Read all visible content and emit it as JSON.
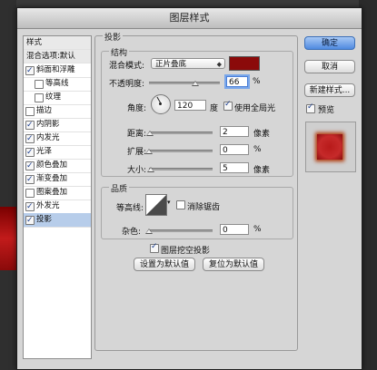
{
  "window": {
    "title": "图层样式"
  },
  "sidebar": {
    "items": [
      {
        "label": "样式",
        "checkbox": false,
        "checked": false,
        "head": true,
        "indent": 0
      },
      {
        "label": "混合选项:默认",
        "checkbox": false,
        "checked": false,
        "head": true,
        "indent": 0
      },
      {
        "label": "斜面和浮雕",
        "checkbox": true,
        "checked": true,
        "indent": 0
      },
      {
        "label": "等高线",
        "checkbox": true,
        "checked": false,
        "indent": 1
      },
      {
        "label": "纹理",
        "checkbox": true,
        "checked": false,
        "indent": 1
      },
      {
        "label": "描边",
        "checkbox": true,
        "checked": false,
        "indent": 0
      },
      {
        "label": "内阴影",
        "checkbox": true,
        "checked": true,
        "indent": 0
      },
      {
        "label": "内发光",
        "checkbox": true,
        "checked": true,
        "indent": 0
      },
      {
        "label": "光泽",
        "checkbox": true,
        "checked": true,
        "indent": 0
      },
      {
        "label": "颜色叠加",
        "checkbox": true,
        "checked": true,
        "indent": 0
      },
      {
        "label": "渐变叠加",
        "checkbox": true,
        "checked": true,
        "indent": 0
      },
      {
        "label": "图案叠加",
        "checkbox": true,
        "checked": false,
        "indent": 0
      },
      {
        "label": "外发光",
        "checkbox": true,
        "checked": true,
        "indent": 0
      },
      {
        "label": "投影",
        "checkbox": true,
        "checked": true,
        "indent": 0,
        "selected": true
      }
    ]
  },
  "drop_shadow": {
    "title": "投影",
    "structure": {
      "title": "结构",
      "blend_mode_label": "混合模式:",
      "blend_mode_value": "正片叠底",
      "shadow_color": "#8b0a0a",
      "opacity_label": "不透明度:",
      "opacity_value": "66",
      "opacity_unit": "%",
      "opacity_fraction": 0.66,
      "angle_label": "角度:",
      "angle_value": "120",
      "angle_unit": "度",
      "global_light_label": "使用全局光",
      "global_light_checked": true,
      "distance_label": "距离:",
      "distance_value": "2",
      "distance_unit": "像素",
      "distance_fraction": 0.02,
      "spread_label": "扩展:",
      "spread_value": "0",
      "spread_unit": "%",
      "spread_fraction": 0.0,
      "size_label": "大小:",
      "size_value": "5",
      "size_unit": "像素",
      "size_fraction": 0.03
    },
    "quality": {
      "title": "品质",
      "contour_label": "等高线:",
      "antialias_label": "消除锯齿",
      "antialias_checked": false,
      "noise_label": "杂色:",
      "noise_value": "0",
      "noise_unit": "%",
      "noise_fraction": 0.0
    },
    "knockout_label": "图层挖空投影",
    "knockout_checked": true,
    "set_default_label": "设置为默认值",
    "reset_default_label": "复位为默认值"
  },
  "buttons": {
    "ok": "确定",
    "cancel": "取消",
    "new_style": "新建样式...",
    "preview_label": "预览",
    "preview_checked": true
  },
  "colors": {
    "accent": "#4f8ae0",
    "selection": "#b7cdea",
    "preview_swatch": "#b81a1a"
  }
}
